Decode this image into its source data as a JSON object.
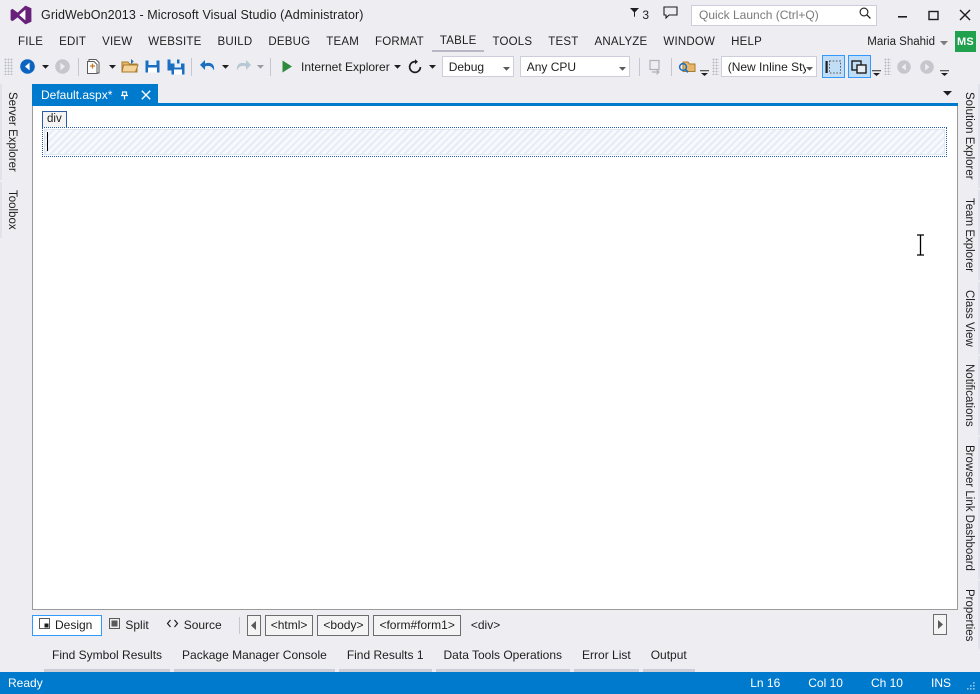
{
  "window": {
    "title": "GridWebOn2013 - Microsoft Visual Studio (Administrator)",
    "logo_icon": "visual-studio-logo",
    "notifications": {
      "icon": "flag-icon",
      "count": "3"
    },
    "feedback_icon": "feedback-speech-bubble-icon",
    "controls": {
      "minimize_icon": "minimize-icon",
      "maximize_icon": "maximize-icon",
      "close_icon": "close-icon"
    }
  },
  "quick_launch": {
    "placeholder": "Quick Launch (Ctrl+Q)",
    "value": "",
    "search_icon": "search-icon"
  },
  "menubar": {
    "items": [
      {
        "label": "FILE"
      },
      {
        "label": "EDIT"
      },
      {
        "label": "VIEW"
      },
      {
        "label": "WEBSITE"
      },
      {
        "label": "BUILD"
      },
      {
        "label": "DEBUG"
      },
      {
        "label": "TEAM"
      },
      {
        "label": "FORMAT"
      },
      {
        "label": "TABLE"
      },
      {
        "label": "TOOLS"
      },
      {
        "label": "TEST"
      },
      {
        "label": "ANALYZE"
      },
      {
        "label": "WINDOW"
      },
      {
        "label": "HELP"
      }
    ],
    "account": {
      "name": "Maria Shahid",
      "caret_icon": "chevron-down-icon",
      "avatar_initials": "MS",
      "avatar_color": "#20a14e"
    }
  },
  "toolbar": {
    "navigate_back_icon": "navigate-back-icon",
    "navigate_forward_icon": "navigate-forward-icon",
    "new_item_icon": "new-item-icon",
    "open_file_icon": "open-file-icon",
    "save_icon": "save-icon",
    "save_all_icon": "save-all-icon",
    "undo_icon": "undo-icon",
    "redo_icon": "redo-icon",
    "start_icon": "start-debug-play-icon",
    "start_target": "Internet Explorer",
    "refresh_icon": "refresh-icon",
    "configuration": "Debug",
    "platform": "Any CPU",
    "step_icon": "step-into-icon",
    "find_in_files_icon": "find-in-files-icon",
    "style_target": "(New Inline Style",
    "style_application_icon": "style-application-icon",
    "attach_style_sheet_icon": "attach-style-sheet-icon",
    "nav_prev_icon": "nav-previous-icon",
    "nav_next_icon": "nav-next-icon",
    "overflow_icon": "toolbar-overflow-icon"
  },
  "left_tabs": [
    {
      "label": "Server Explorer"
    },
    {
      "label": "Toolbox"
    }
  ],
  "right_tabs": [
    {
      "label": "Solution Explorer"
    },
    {
      "label": "Team Explorer"
    },
    {
      "label": "Class View"
    },
    {
      "label": "Notifications"
    },
    {
      "label": "Browser Link Dashboard"
    },
    {
      "label": "Properties"
    }
  ],
  "document": {
    "tab_title": "Default.aspx*",
    "pin_icon": "pin-icon",
    "close_icon": "close-icon",
    "tabstrip_caret_icon": "chevron-down-icon",
    "accent_color": "#007acc"
  },
  "designer": {
    "selected_tag_badge": "div",
    "content_text": ""
  },
  "viewbar": {
    "buttons": [
      {
        "label": "Design",
        "icon": "design-view-icon",
        "active": true
      },
      {
        "label": "Split",
        "icon": "split-view-icon",
        "active": false
      },
      {
        "label": "Source",
        "icon": "source-view-icon",
        "active": false
      }
    ],
    "scroll_left_icon": "scroll-left-arrow-icon",
    "scroll_right_icon": "scroll-right-arrow-icon",
    "tag_navigator": [
      {
        "label": "<html>",
        "boxed": true
      },
      {
        "label": "<body>",
        "boxed": true
      },
      {
        "label": "<form#form1>",
        "boxed": true
      },
      {
        "label": "<div>",
        "boxed": false
      }
    ]
  },
  "tool_tabs": [
    {
      "label": "Find Symbol Results"
    },
    {
      "label": "Package Manager Console"
    },
    {
      "label": "Find Results 1"
    },
    {
      "label": "Data Tools Operations"
    },
    {
      "label": "Error List"
    },
    {
      "label": "Output"
    }
  ],
  "statusbar": {
    "message": "Ready",
    "line": "Ln 16",
    "column": "Col 10",
    "character": "Ch 10",
    "insert_mode": "INS",
    "background_color": "#007acc",
    "resize_grip_icon": "resize-grip-icon"
  }
}
